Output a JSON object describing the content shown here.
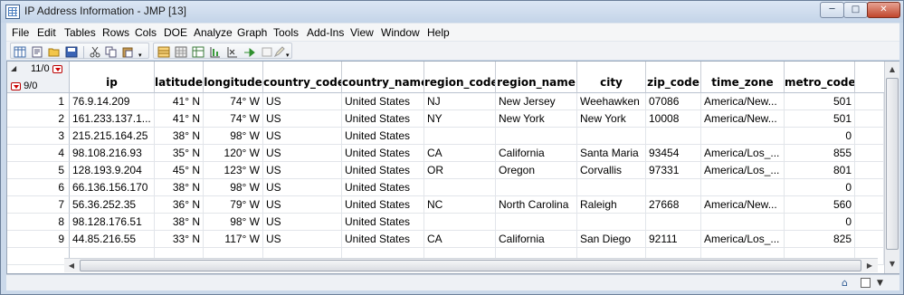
{
  "window": {
    "title": "IP Address Information - JMP [13]"
  },
  "menu": [
    "File",
    "Edit",
    "Tables",
    "Rows",
    "Cols",
    "DOE",
    "Analyze",
    "Graph",
    "Tools",
    "Add-Ins",
    "View",
    "Window",
    "Help"
  ],
  "toolbar": {
    "icons": [
      "new-table-icon",
      "new-script-icon",
      "open-icon",
      "save-icon",
      "cut-icon",
      "copy-icon",
      "paste-icon",
      "data-table-icon",
      "grid-icon",
      "select-icon",
      "chart-icon",
      "distribution-icon",
      "fit-icon",
      "annotate-icon",
      "pencil-icon"
    ]
  },
  "table": {
    "columns_summary": "11/0",
    "rows_summary": "9/0",
    "columns": [
      "ip",
      "latitude",
      "longitude",
      "country_code",
      "country_name",
      "region_code",
      "region_name",
      "city",
      "zip_code",
      "time_zone",
      "metro_code"
    ],
    "rows": [
      [
        "1",
        "76.9.14.209",
        "41° N",
        "74° W",
        "US",
        "United States",
        "NJ",
        "New Jersey",
        "Weehawken",
        "07086",
        "America/New...",
        "501"
      ],
      [
        "2",
        "161.233.137.1...",
        "41° N",
        "74° W",
        "US",
        "United States",
        "NY",
        "New York",
        "New York",
        "10008",
        "America/New...",
        "501"
      ],
      [
        "3",
        "215.215.164.25",
        "38° N",
        "98° W",
        "US",
        "United States",
        "",
        "",
        "",
        "",
        "",
        "0"
      ],
      [
        "4",
        "98.108.216.93",
        "35° N",
        "120° W",
        "US",
        "United States",
        "CA",
        "California",
        "Santa Maria",
        "93454",
        "America/Los_...",
        "855"
      ],
      [
        "5",
        "128.193.9.204",
        "45° N",
        "123° W",
        "US",
        "United States",
        "OR",
        "Oregon",
        "Corvallis",
        "97331",
        "America/Los_...",
        "801"
      ],
      [
        "6",
        "66.136.156.170",
        "38° N",
        "98° W",
        "US",
        "United States",
        "",
        "",
        "",
        "",
        "",
        "0"
      ],
      [
        "7",
        "56.36.252.35",
        "36° N",
        "79° W",
        "US",
        "United States",
        "NC",
        "North Carolina",
        "Raleigh",
        "27668",
        "America/New...",
        "560"
      ],
      [
        "8",
        "98.128.176.51",
        "38° N",
        "98° W",
        "US",
        "United States",
        "",
        "",
        "",
        "",
        "",
        "0"
      ],
      [
        "9",
        "44.85.216.55",
        "33° N",
        "117° W",
        "US",
        "United States",
        "CA",
        "California",
        "San Diego",
        "92111",
        "America/Los_...",
        "825"
      ]
    ]
  }
}
